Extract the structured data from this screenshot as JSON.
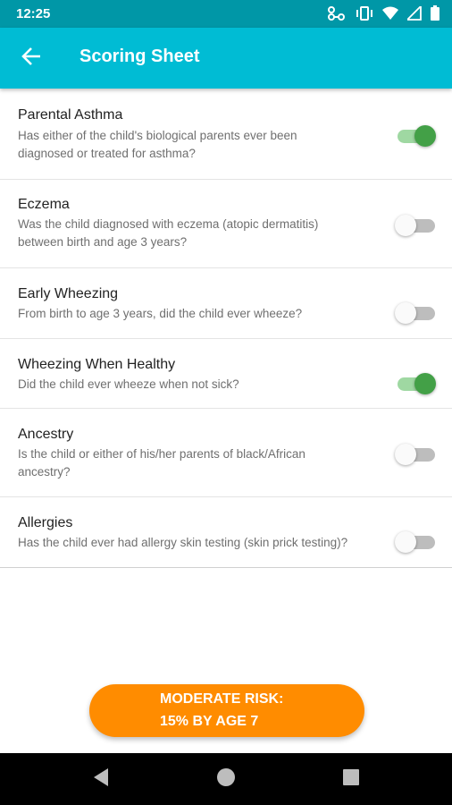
{
  "status_bar": {
    "time": "12:25",
    "icons": [
      "link-icon",
      "vibrate-icon",
      "wifi-icon",
      "signal-icon",
      "battery-icon"
    ]
  },
  "app_bar": {
    "title": "Scoring Sheet",
    "back_icon": "arrow-left-icon",
    "color": "#00bcd4"
  },
  "questions": [
    {
      "title": "Parental Asthma",
      "desc_lines": [
        "Has either of the child's biological parents ever been",
        "diagnosed or treated for asthma?"
      ],
      "enabled": true
    },
    {
      "title": "Eczema",
      "desc_lines": [
        "Was the child diagnosed with eczema (atopic dermatitis)",
        "between birth and age 3 years?"
      ],
      "enabled": false
    },
    {
      "title": "Early Wheezing",
      "desc_lines": [
        "From birth to age 3 years, did the child ever wheeze?"
      ],
      "enabled": false
    },
    {
      "title": "Wheezing When Healthy",
      "desc_lines": [
        "Did the child ever wheeze when not sick?"
      ],
      "enabled": true
    },
    {
      "title": "Ancestry",
      "desc_lines": [
        "Is the child or either of his/her parents of black/African",
        "ancestry?"
      ],
      "enabled": false
    },
    {
      "title": "Allergies",
      "desc_lines": [
        "Has the child ever had allergy skin testing (skin prick testing)?"
      ],
      "enabled": false
    }
  ],
  "risk_button": {
    "line1": "MODERATE RISK:",
    "line2": "15% BY AGE 7",
    "color": "#ff8c00"
  },
  "nav_bar": {
    "buttons": [
      "back-triangle-icon",
      "home-circle-icon",
      "recents-square-icon"
    ]
  },
  "colors": {
    "switch_on": "#43a047",
    "switch_on_track": "#9fd8a2",
    "switch_off_thumb": "#fafafa",
    "switch_off_track": "#bdbdbd"
  }
}
